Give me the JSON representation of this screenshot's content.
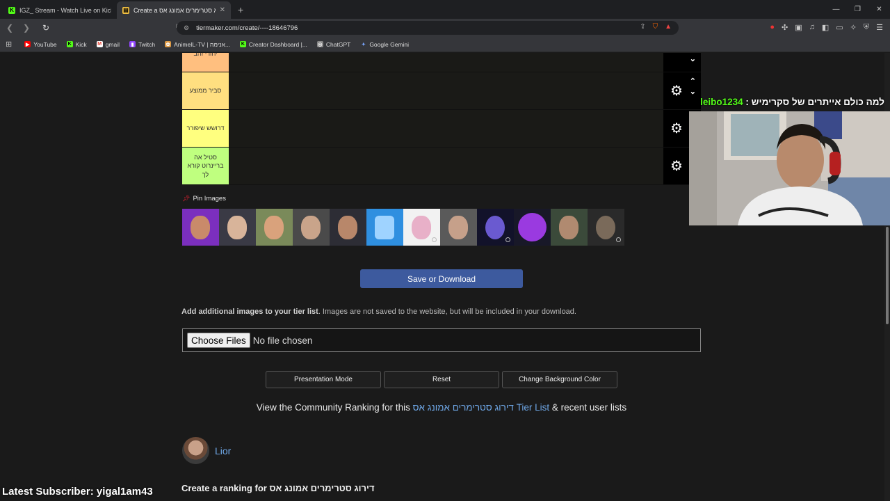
{
  "browser": {
    "tabs": [
      {
        "label": "IGZ_ Stream - Watch Live on Kick",
        "icon": "kick-icon",
        "color": "#53fc18",
        "active": false
      },
      {
        "label": "Create a דירוג סטרימרים אמונג אס",
        "icon": "tiermaker-icon",
        "color": "#f5c242",
        "active": true
      }
    ],
    "new_tab": "+",
    "url": "tiermaker.com/create/----18646796",
    "bookmarks": [
      {
        "label": "YouTube",
        "icon": "youtube-icon",
        "color": "#ff0000"
      },
      {
        "label": "Kick",
        "icon": "kick-icon",
        "color": "#53fc18"
      },
      {
        "label": "gmail",
        "icon": "gmail-icon",
        "color": "#ea4335"
      },
      {
        "label": "Twitch",
        "icon": "twitch-icon",
        "color": "#9146ff"
      },
      {
        "label": "AnimeIL-TV | אנימה...",
        "icon": "animeil-icon",
        "color": "#d94"
      },
      {
        "label": "Creator Dashboard |...",
        "icon": "kick-icon",
        "color": "#53fc18"
      },
      {
        "label": "ChatGPT",
        "icon": "chatgpt-icon",
        "color": "#888"
      },
      {
        "label": "Google Gemini",
        "icon": "gemini-icon",
        "color": "#7aa7ff"
      }
    ]
  },
  "tiers": [
    {
      "label": "יחורי זהב",
      "color": "#ffbf7f"
    },
    {
      "label": "סביר ממוצע",
      "color": "#ffdf80"
    },
    {
      "label": "דרושש שיפורר",
      "color": "#ffff7f"
    },
    {
      "label": "סטיל אה בריינרוט קורא לך",
      "color": "#bfff7f"
    }
  ],
  "pin_images": {
    "title": "Pin Images",
    "items": [
      {
        "name": "streamer-1",
        "bg": "#7b2fbe",
        "face": "#c98a6a"
      },
      {
        "name": "streamer-2",
        "bg": "#3a3a45",
        "face": "#d8b49a"
      },
      {
        "name": "streamer-3",
        "bg": "#7a8a5a",
        "face": "#d9a27c"
      },
      {
        "name": "streamer-4",
        "bg": "#4a4a4a",
        "face": "#c9a48a"
      },
      {
        "name": "streamer-5",
        "bg": "#2d2d35",
        "face": "#b8876a"
      },
      {
        "name": "streamer-6",
        "bg": "#2f8fe0",
        "face": "#9fd3ff"
      },
      {
        "name": "streamer-7",
        "bg": "#f2f2f2",
        "face": "#e8b0c8"
      },
      {
        "name": "streamer-8",
        "bg": "#5a5a5a",
        "face": "#c6a08a"
      },
      {
        "name": "streamer-9",
        "bg": "#12122a",
        "face": "#6a5ad0"
      },
      {
        "name": "streamer-10",
        "bg": "#181828",
        "face": "#9a3ae0"
      },
      {
        "name": "streamer-11",
        "bg": "#3b4a3a",
        "face": "#b08a70"
      },
      {
        "name": "streamer-12",
        "bg": "#2a2a2a",
        "face": "#7a6a5a"
      }
    ]
  },
  "save_button": "Save or Download",
  "add_images": {
    "bold": "Add additional images to your tier list",
    "rest": ". Images are not saved to the website, but will be included in your download."
  },
  "file_input": {
    "button": "Choose Files",
    "status": "No file chosen"
  },
  "actions": {
    "presentation": "Presentation Mode",
    "reset": "Reset",
    "background": "Change Background Color"
  },
  "community": {
    "prefix": "View the Community Ranking for this ",
    "link": "דירוג סטרימרים אמונג אס Tier List",
    "suffix": " & recent user lists"
  },
  "author": {
    "name": "Lior"
  },
  "create_title": "Create a ranking for דירוג סטרימרים אמונג אס",
  "stream": {
    "chat_user": "leibo1234",
    "chat_sep": " : ",
    "chat_text": "למה כולם אייתרים של סקרימיש",
    "latest_subscriber": "Latest Subscriber: yigal1am43"
  }
}
